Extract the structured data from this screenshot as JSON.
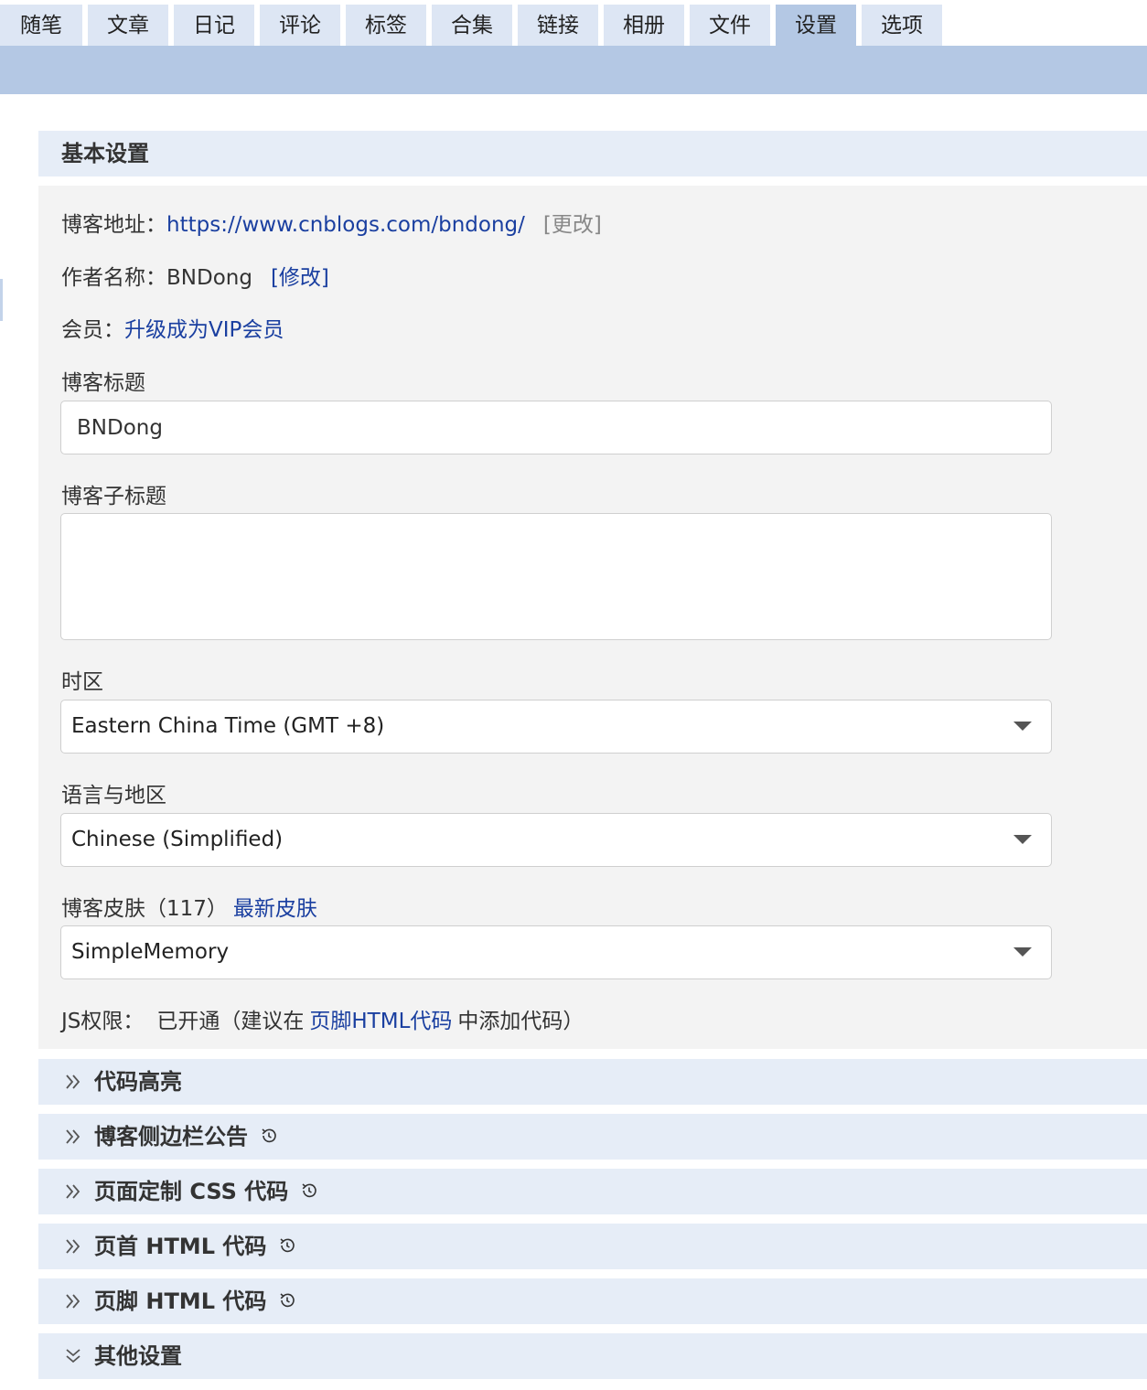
{
  "tabs": [
    {
      "label": "随笔"
    },
    {
      "label": "文章"
    },
    {
      "label": "日记"
    },
    {
      "label": "评论"
    },
    {
      "label": "标签"
    },
    {
      "label": "合集"
    },
    {
      "label": "链接"
    },
    {
      "label": "相册"
    },
    {
      "label": "文件"
    },
    {
      "label": "设置",
      "active": true
    },
    {
      "label": "选项"
    }
  ],
  "basic": {
    "header": "基本设置",
    "blog_address_label": "博客地址：",
    "blog_address_url": "https://www.cnblogs.com/bndong/",
    "blog_address_change": "[更改]",
    "author_label": "作者名称：",
    "author_name": "BNDong",
    "author_modify": "[修改]",
    "member_label": "会员：",
    "member_link": "升级成为VIP会员",
    "title_label": "博客标题",
    "title_value": "BNDong",
    "subtitle_label": "博客子标题",
    "subtitle_value": "",
    "timezone_label": "时区",
    "timezone_value": "Eastern China Time (GMT +8)",
    "locale_label": "语言与地区",
    "locale_value": "Chinese (Simplified)",
    "skin_label": "博客皮肤（117）",
    "skin_link": "最新皮肤",
    "skin_value": "SimpleMemory",
    "js_label": "JS权限：",
    "js_status_pre": "已开通（建议在",
    "js_status_link": "页脚HTML代码",
    "js_status_post": "中添加代码）"
  },
  "sections": [
    {
      "title": "代码高亮",
      "history": false,
      "expanded": false
    },
    {
      "title": "博客侧边栏公告",
      "history": true,
      "expanded": false
    },
    {
      "title": "页面定制 CSS 代码",
      "history": true,
      "expanded": false
    },
    {
      "title": "页首 HTML 代码",
      "history": true,
      "expanded": false
    },
    {
      "title": "页脚 HTML 代码",
      "history": true,
      "expanded": false
    },
    {
      "title": "其他设置",
      "history": false,
      "expanded": true
    }
  ],
  "icons": {
    "collapsed": "double-chevron-right-icon",
    "expanded": "double-chevron-down-icon",
    "history": "history-icon"
  },
  "colors": {
    "tab_bg": "#dde6f4",
    "tab_active_bg": "#b4c8e4",
    "section_header_bg": "#e6edf7",
    "panel_bg": "#f3f3f3",
    "link": "#1a3fa0"
  }
}
